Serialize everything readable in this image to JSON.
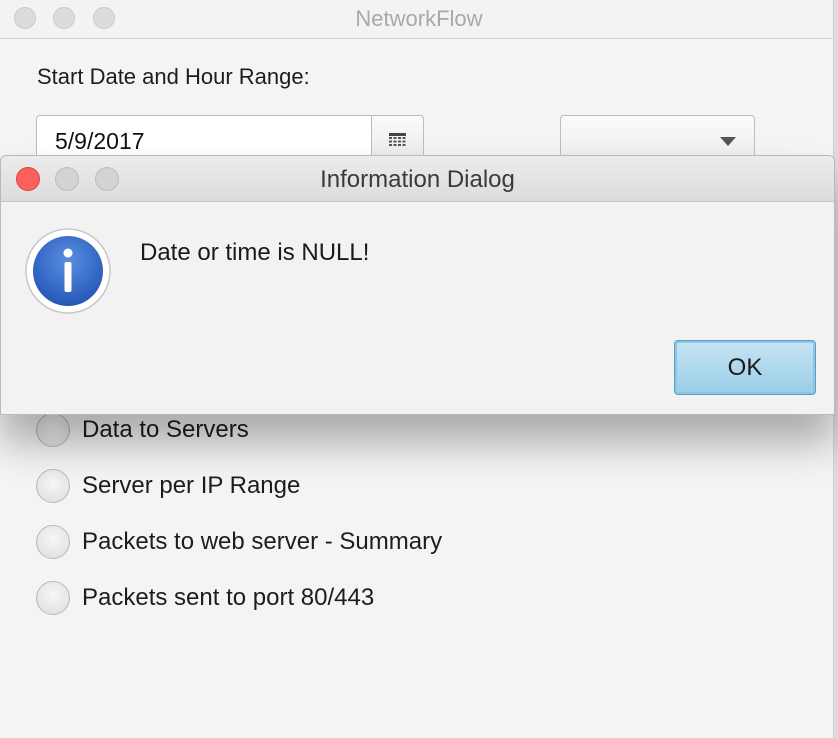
{
  "window": {
    "title": "NetworkFlow"
  },
  "form": {
    "start_label": "Start Date and Hour Range:",
    "date_value": "5/9/2017",
    "hour_value": ""
  },
  "options": [
    {
      "label": "Data to Servers"
    },
    {
      "label": "Server per IP Range"
    },
    {
      "label": "Packets to web server - Summary"
    },
    {
      "label": "Packets sent to port 80/443"
    }
  ],
  "dialog": {
    "title": "Information Dialog",
    "message": "Date or time is NULL!",
    "icon": "info-icon",
    "ok_label": "OK",
    "close_color": "#fc605c",
    "accent_color": "#98cde6"
  }
}
